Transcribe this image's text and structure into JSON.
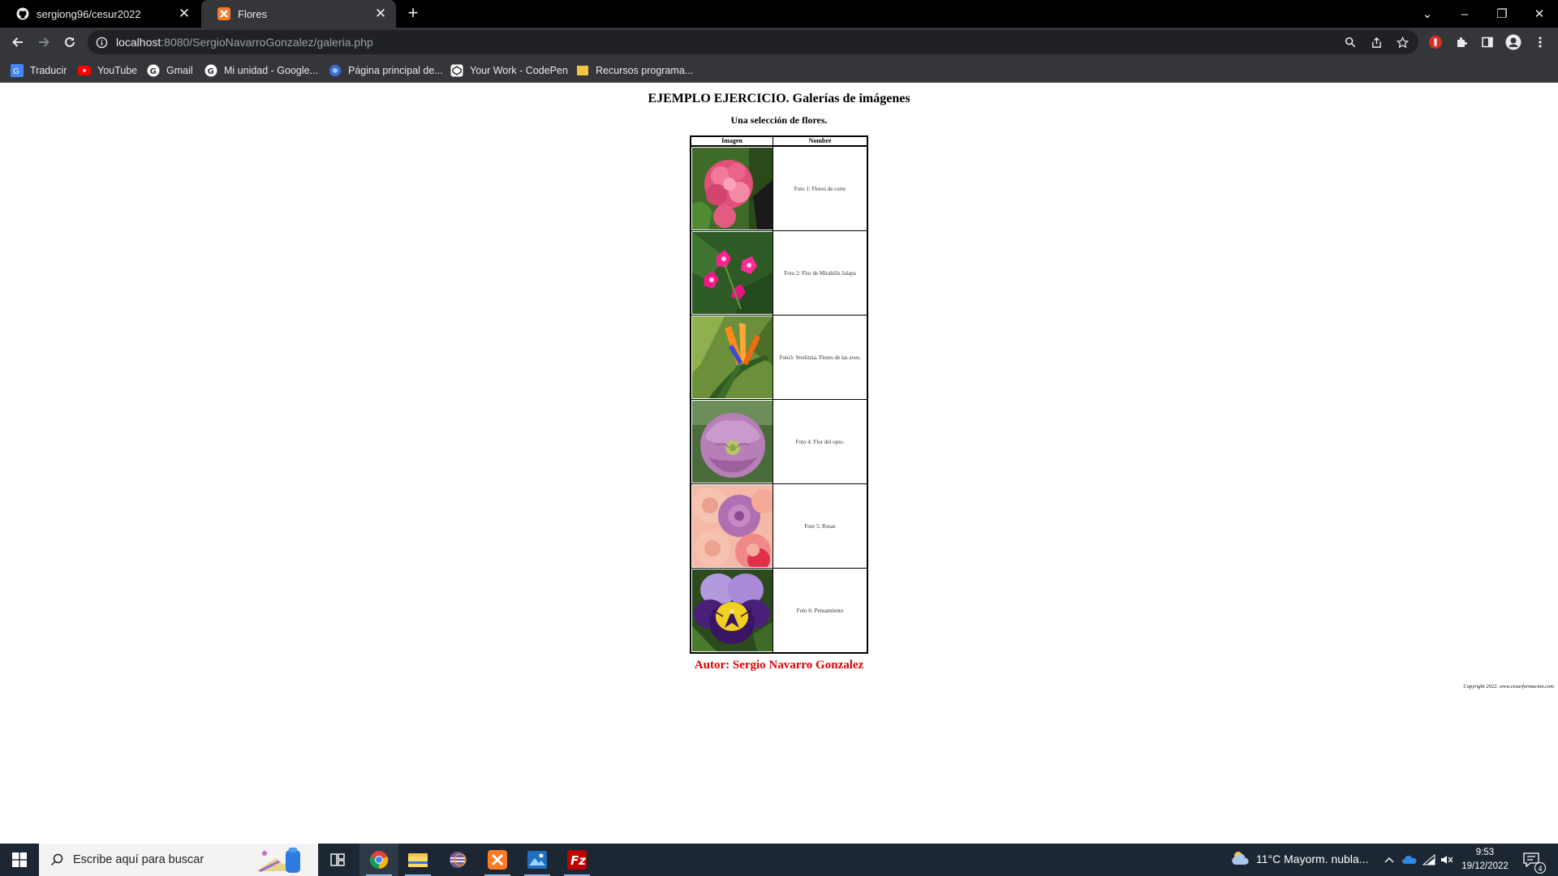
{
  "browser": {
    "tabs": [
      {
        "title": "sergiong96/cesur2022",
        "icon": "github-icon",
        "active": false
      },
      {
        "title": "Flores",
        "icon": "xampp-icon",
        "active": true
      }
    ],
    "url_host": "localhost",
    "url_rest": ":8080/SergioNavarroGonzalez/galeria.php",
    "bookmarks": [
      {
        "label": "Traducir",
        "icon": "translate-icon"
      },
      {
        "label": "YouTube",
        "icon": "youtube-icon"
      },
      {
        "label": "Gmail",
        "icon": "google-icon"
      },
      {
        "label": "Mi unidad - Google...",
        "icon": "google-icon"
      },
      {
        "label": "Página principal de...",
        "icon": "blue-shield-icon"
      },
      {
        "label": "Your Work - CodePen",
        "icon": "codepen-icon"
      },
      {
        "label": "Recursos programa...",
        "icon": "folder-icon"
      }
    ]
  },
  "page": {
    "heading": "EJEMPLO EJERCICIO. Galerías de imágenes",
    "subheading": "Una selección de flores.",
    "table_headers": [
      "Imagen",
      "Nombre"
    ],
    "photos": [
      {
        "caption": "Foto 1: Flores de corte",
        "image": "pink-hydrangea"
      },
      {
        "caption": "Foto 2: Flor de Mirabilis Jalapa",
        "image": "magenta-mirabilis"
      },
      {
        "caption": "Foto3: Strelitzia. Flores de las aves.",
        "image": "bird-of-paradise"
      },
      {
        "caption": "Foto 4: Flor del opio.",
        "image": "purple-poppy"
      },
      {
        "caption": "Foto 5: Rosas",
        "image": "roses"
      },
      {
        "caption": "Foto 6: Pensamiento",
        "image": "pansy"
      }
    ],
    "author": "Autor: Sergio Navarro Gonzalez",
    "copyright": "Copyright 2022. www.cesurformacion.com"
  },
  "taskbar": {
    "search_placeholder": "Escribe aquí para buscar",
    "weather": "11°C  Mayorm. nubla...",
    "time": "9:53",
    "date": "19/12/2022",
    "notifications": "4"
  },
  "colors": {
    "author": "#e00000",
    "chrome_dark": "#35363a",
    "taskbar": "#1c2733"
  }
}
